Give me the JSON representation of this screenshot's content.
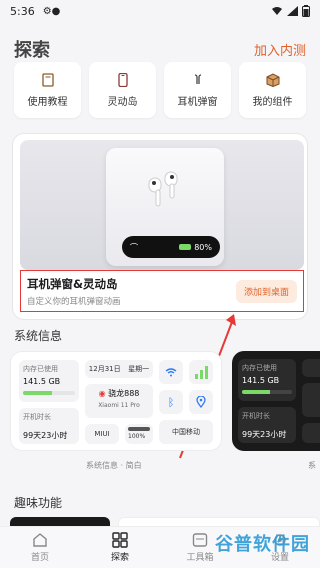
{
  "status": {
    "time": "5:36",
    "battery": ""
  },
  "header": {
    "title": "探索",
    "join_label": "加入内测"
  },
  "shortcuts": [
    {
      "label": "使用教程",
      "icon": "book-icon"
    },
    {
      "label": "灵动岛",
      "icon": "phone-icon"
    },
    {
      "label": "耳机弹窗",
      "icon": "earbuds-icon"
    },
    {
      "label": "我的组件",
      "icon": "box-icon"
    }
  ],
  "feature": {
    "title": "耳机弹窗&灵动岛",
    "subtitle": "自定义你的耳机弹窗动画",
    "button_label": "添加到桌面",
    "popup_battery": "80%"
  },
  "system_info": {
    "section_title": "系统信息",
    "memory_label": "内存已使用",
    "memory_value": "141.5 GB",
    "memory_percent": 55,
    "date": "12月31日",
    "weekday": "星期一",
    "chip": "骁龙888",
    "device": "Xiaomi 11 Pro",
    "uptime_label": "开机时长",
    "uptime_value": "99天23小时",
    "os": "MIUI",
    "storage_percent_label": "100%",
    "carrier": "中国移动",
    "caption": "系统信息 · 简白",
    "dark_caption": "系"
  },
  "fun": {
    "section_title": "趣味功能"
  },
  "nav": [
    {
      "label": "首页",
      "icon": "home-icon"
    },
    {
      "label": "探索",
      "icon": "grid-icon"
    },
    {
      "label": "工具箱",
      "icon": "toolbox-icon"
    },
    {
      "label": "设置",
      "icon": "settings-icon"
    }
  ],
  "watermark": "谷普软件园",
  "colors": {
    "accent": "#e0622b",
    "highlight_border": "#e53935",
    "green": "#7bd967"
  }
}
